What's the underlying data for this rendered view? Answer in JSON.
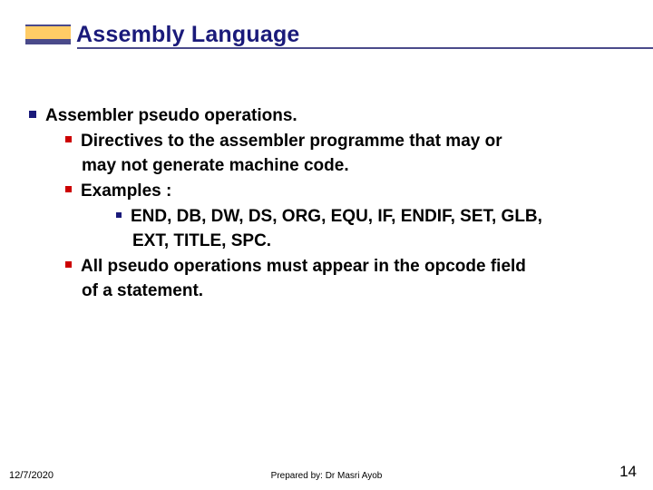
{
  "title": "Assembly Language",
  "body": {
    "heading": "Assembler pseudo operations.",
    "b1_line1": "Directives to the assembler programme that may or",
    "b1_line2": "may not generate machine code.",
    "b2": "Examples :",
    "b2a_line1": "END, DB, DW, DS, ORG, EQU, IF, ENDIF, SET, GLB,",
    "b2a_line2": "EXT, TITLE, SPC.",
    "b3_line1": "All pseudo operations must appear in the opcode field",
    "b3_line2": "of a statement."
  },
  "footer": {
    "date": "12/7/2020",
    "prepared": "Prepared by: Dr Masri Ayob",
    "page": "14"
  }
}
